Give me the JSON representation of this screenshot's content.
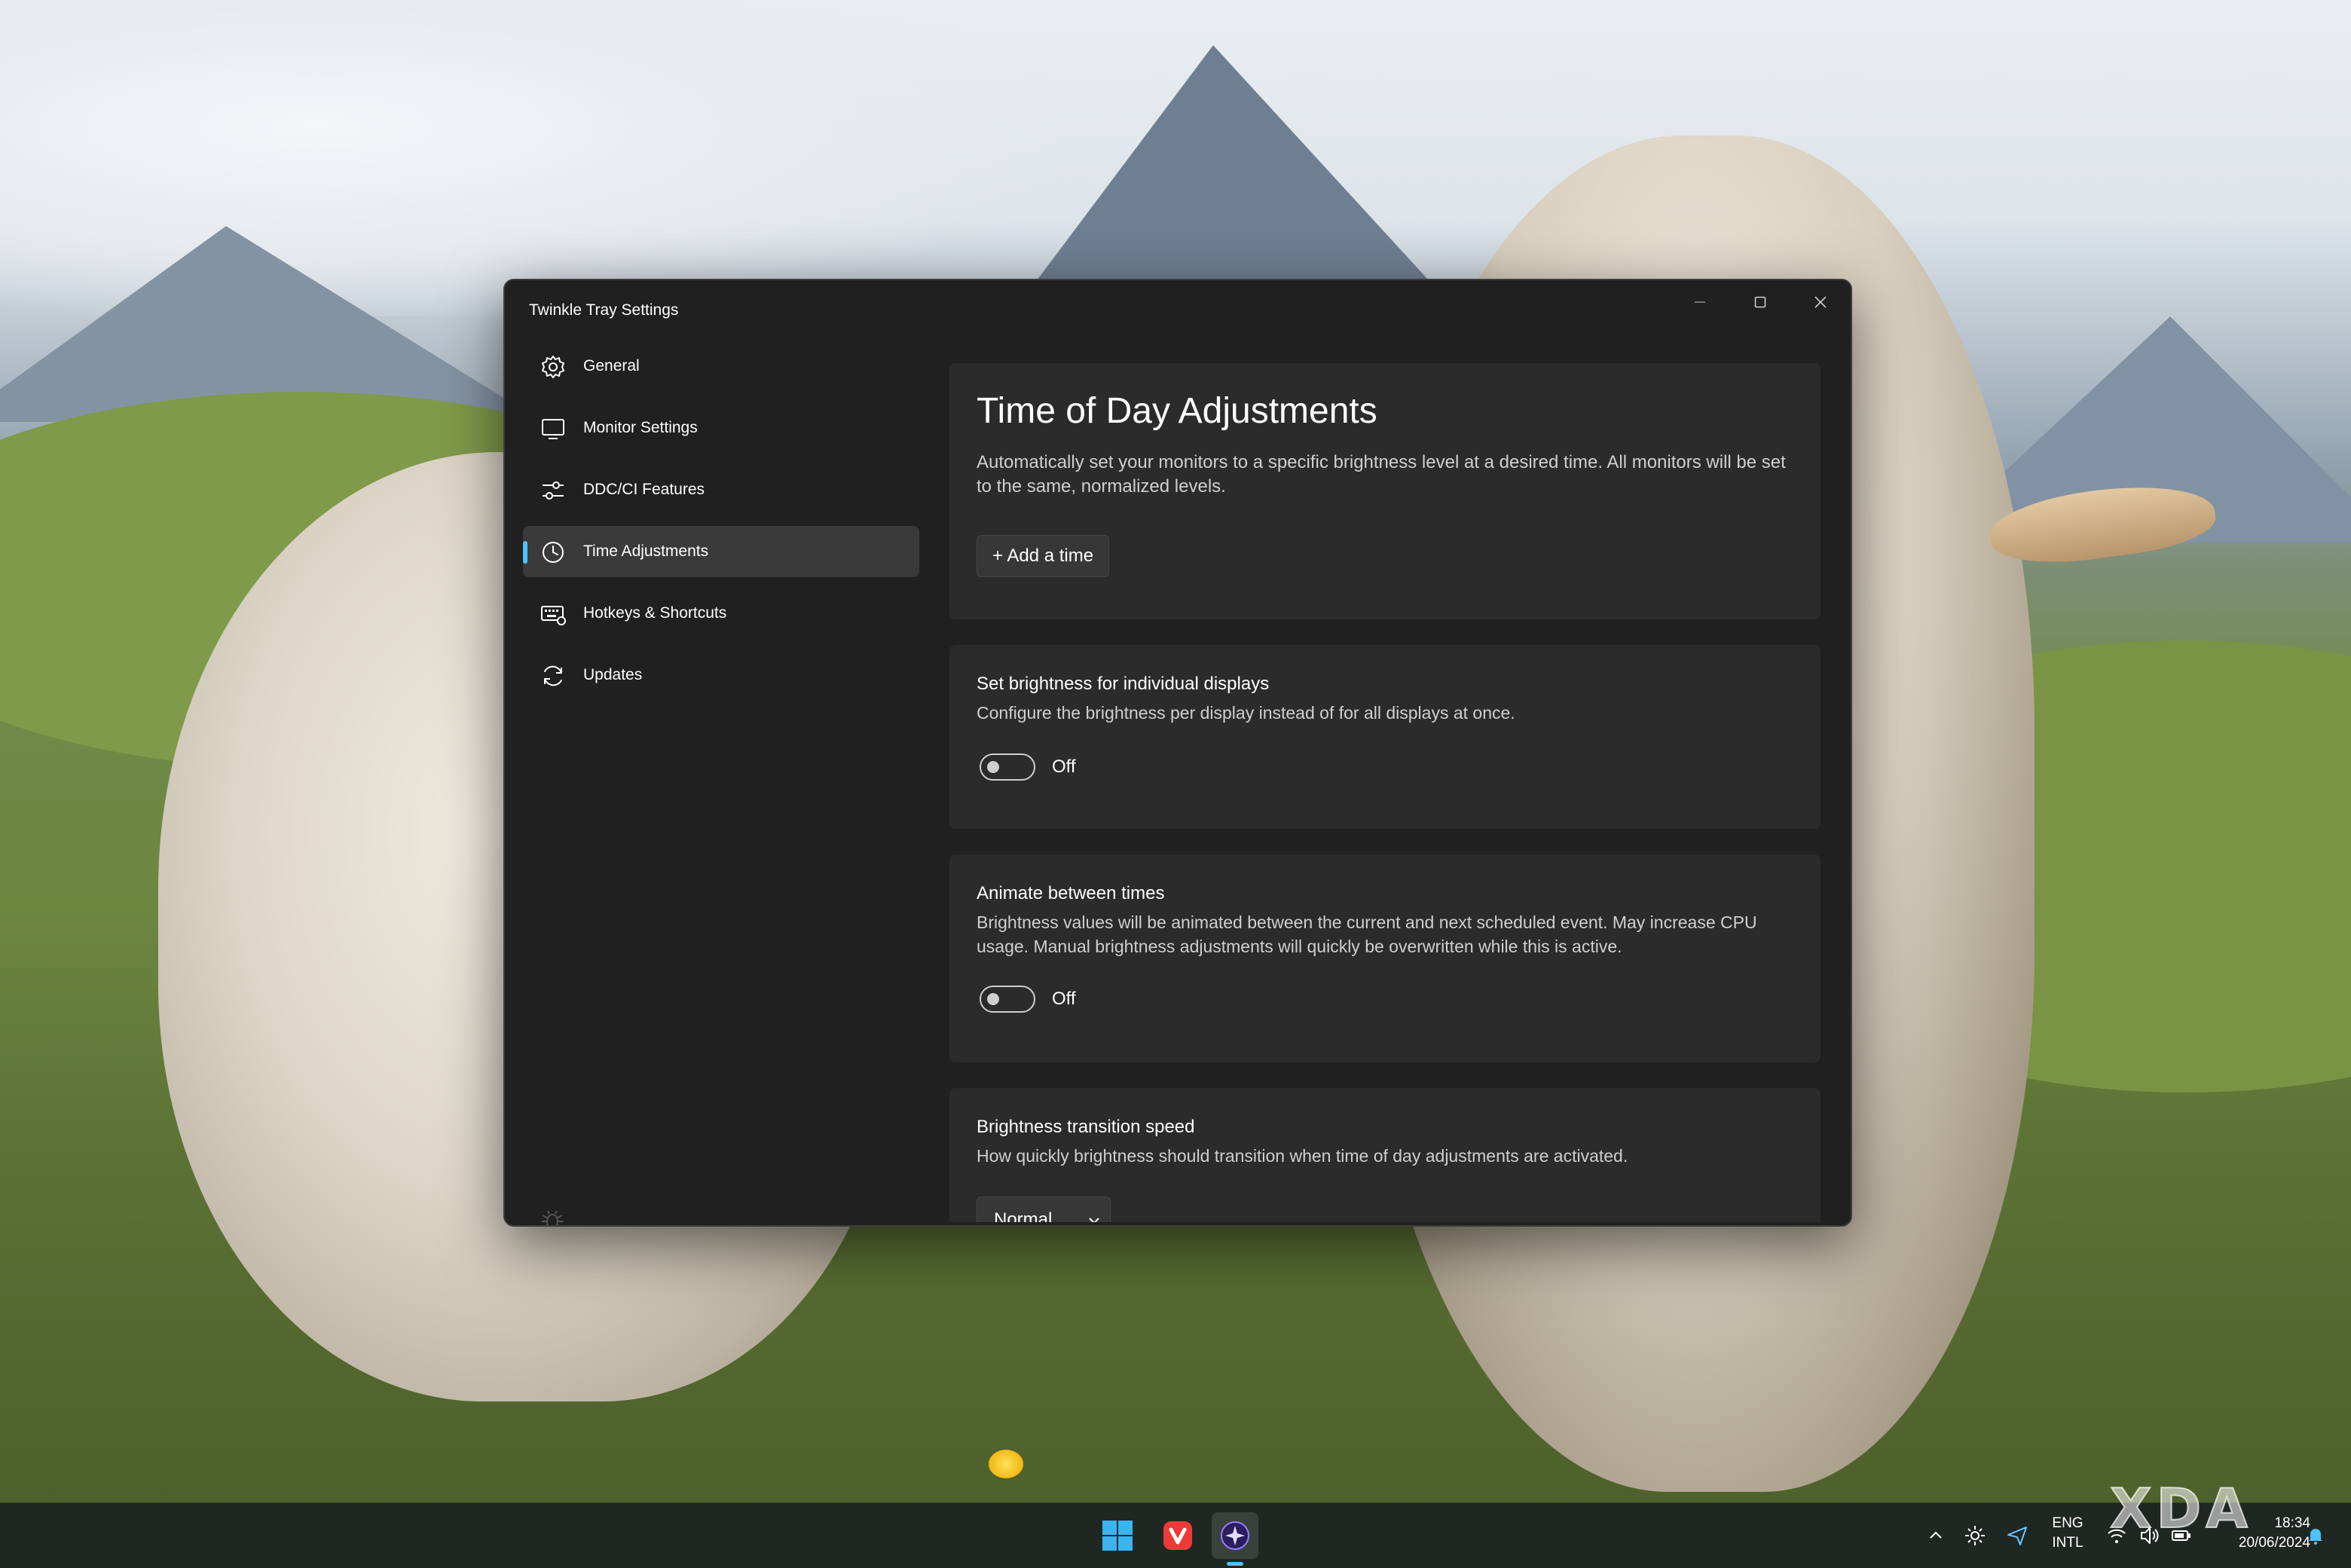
{
  "window": {
    "title": "Twinkle Tray Settings"
  },
  "sidebar": {
    "items": [
      {
        "label": "General",
        "icon": "gear-icon"
      },
      {
        "label": "Monitor Settings",
        "icon": "monitor-icon"
      },
      {
        "label": "DDC/CI Features",
        "icon": "sliders-icon"
      },
      {
        "label": "Time Adjustments",
        "icon": "clock-icon",
        "active": true
      },
      {
        "label": "Hotkeys & Shortcuts",
        "icon": "keyboard-icon"
      },
      {
        "label": "Updates",
        "icon": "refresh-icon"
      }
    ],
    "footer_icon": "bug-icon"
  },
  "main": {
    "title": "Time of Day Adjustments",
    "description": "Automatically set your monitors to a specific brightness level at a desired time. All monitors will be set to the same, normalized levels.",
    "add_time_label": "+ Add a time",
    "individual": {
      "title": "Set brightness for individual displays",
      "description": "Configure the brightness per display instead of for all displays at once.",
      "state": "Off"
    },
    "animate": {
      "title": "Animate between times",
      "description": "Brightness values will be animated between the current and next scheduled event. May increase CPU usage. Manual brightness adjustments will quickly be overwritten while this is active.",
      "state": "Off"
    },
    "speed": {
      "title": "Brightness transition speed",
      "description": "How quickly brightness should transition when time of day adjustments are activated.",
      "value": "Normal"
    }
  },
  "taskbar": {
    "lang_line1": "ENG",
    "lang_line2": "INTL",
    "time": "18:34",
    "date": "20/06/2024"
  },
  "watermark": "XDA",
  "colors": {
    "accent": "#4cc2ff",
    "window_bg": "#202020",
    "card_bg": "#2b2b2b"
  }
}
